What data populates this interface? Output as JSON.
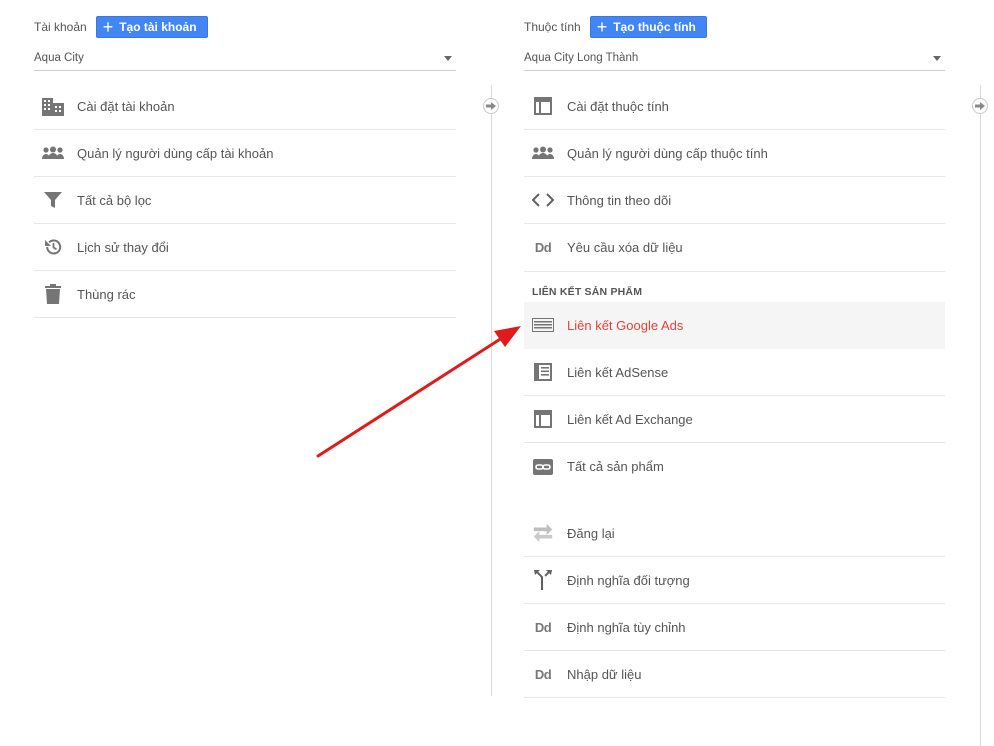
{
  "account": {
    "label": "Tài khoản",
    "create_label": "Tạo tài khoản",
    "selected": "Aqua City",
    "items": [
      {
        "label": "Cài đặt tài khoản",
        "icon": "building-icon"
      },
      {
        "label": "Quản lý người dùng cấp tài khoản",
        "icon": "people-icon"
      },
      {
        "label": "Tất cả bộ lọc",
        "icon": "filter-icon"
      },
      {
        "label": "Lịch sử thay đổi",
        "icon": "history-icon"
      },
      {
        "label": "Thùng rác",
        "icon": "trash-icon"
      }
    ]
  },
  "property": {
    "label": "Thuộc tính",
    "create_label": "Tạo thuộc tính",
    "selected": "Aqua City Long Thành",
    "items": [
      {
        "label": "Cài đặt thuộc tính",
        "icon": "window-icon"
      },
      {
        "label": "Quản lý người dùng cấp thuộc tính",
        "icon": "people-icon"
      },
      {
        "label": "Thông tin theo dõi",
        "icon": "code-icon"
      },
      {
        "label": "Yêu cầu xóa dữ liệu",
        "icon": "dd-icon"
      }
    ],
    "section_title": "LIÊN KẾT SẢN PHẨM",
    "product_links": [
      {
        "label": "Liên kết Google Ads",
        "icon": "ads-card-icon",
        "active": true
      },
      {
        "label": "Liên kết AdSense",
        "icon": "adsense-icon"
      },
      {
        "label": "Liên kết Ad Exchange",
        "icon": "window-icon"
      },
      {
        "label": "Tất cả sản phẩm",
        "icon": "link-icon"
      }
    ],
    "other_items": [
      {
        "label": "Đăng lại",
        "icon": "repost-icon"
      },
      {
        "label": "Định nghĩa đối tượng",
        "icon": "fork-icon"
      },
      {
        "label": "Định nghĩa tùy chỉnh",
        "icon": "dd-icon"
      },
      {
        "label": "Nhập dữ liệu",
        "icon": "dd-icon"
      }
    ]
  },
  "dd_glyph": "Dd",
  "colors": {
    "primary": "#4285f4",
    "active_text": "#e3423a",
    "annotation_arrow": "#e01b1b",
    "icon": "#757575"
  }
}
